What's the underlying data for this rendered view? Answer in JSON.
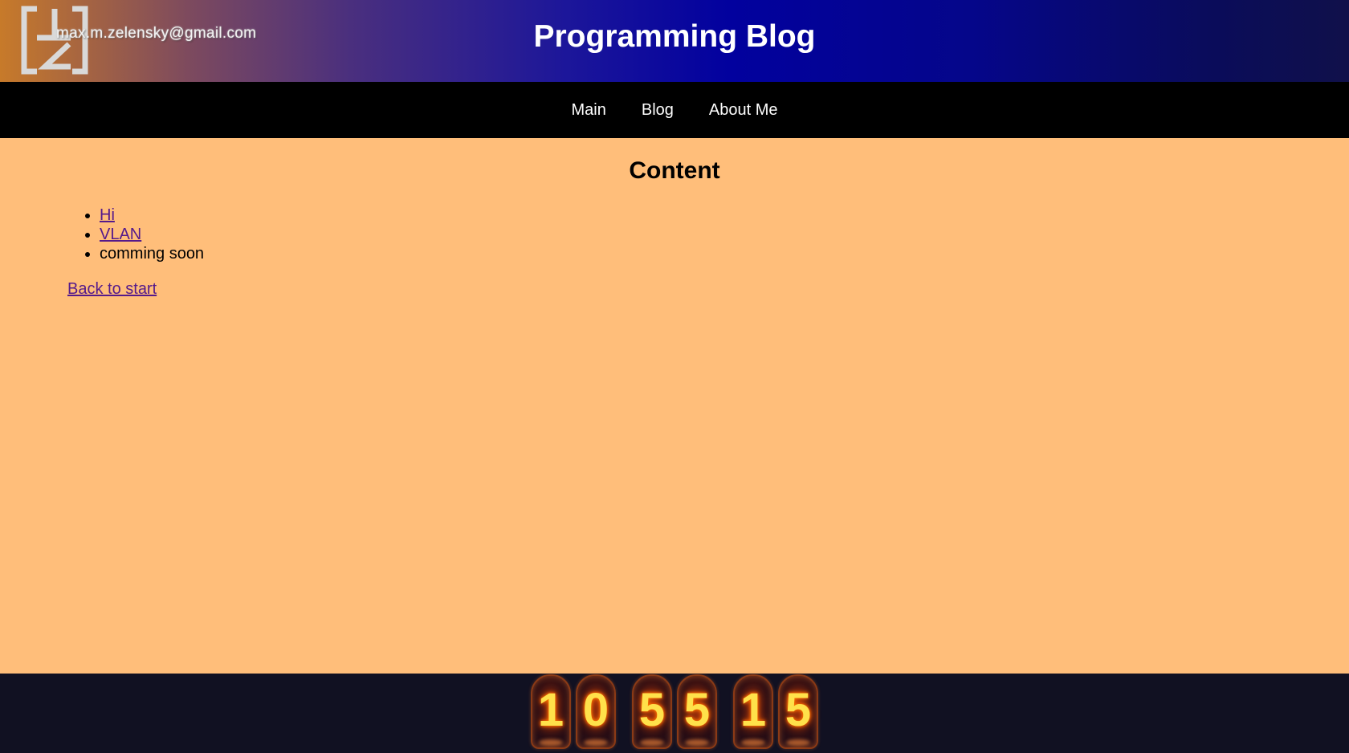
{
  "header": {
    "email": "max.m.zelensky@gmail.com",
    "title": "Programming Blog",
    "logo_icon": "zm-logo-icon"
  },
  "nav": {
    "items": [
      {
        "label": "Main"
      },
      {
        "label": "Blog"
      },
      {
        "label": "About Me"
      }
    ]
  },
  "main": {
    "heading": "Content",
    "list": [
      {
        "label": "Hi",
        "link": true
      },
      {
        "label": "VLAN",
        "link": true
      },
      {
        "label": "comming soon",
        "link": false
      }
    ],
    "back_link": "Back to start"
  },
  "footer": {
    "counter_digits": [
      "1",
      "0",
      "5",
      "5",
      "1",
      "5"
    ]
  },
  "colors": {
    "page_bg": "#ffbe7a",
    "nav_bg": "#000000",
    "footer_bg": "#111122",
    "link": "#551a8b"
  }
}
